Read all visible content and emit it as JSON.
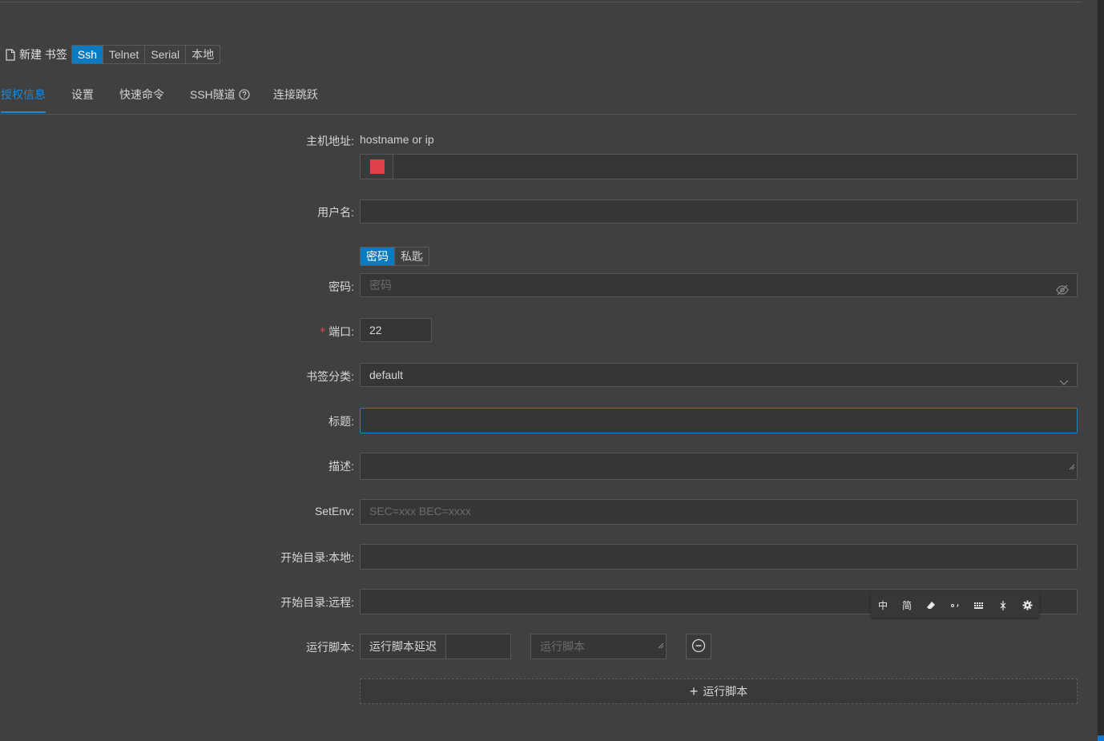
{
  "header": {
    "title": "新建 书签",
    "protocols": [
      "Ssh",
      "Telnet",
      "Serial",
      "本地"
    ],
    "active_protocol": "Ssh"
  },
  "tabs": [
    {
      "label": "授权信息",
      "active": true
    },
    {
      "label": "设置"
    },
    {
      "label": "快速命令"
    },
    {
      "label": "SSH隧道",
      "icon": "question-circle-icon"
    },
    {
      "label": "连接跳跃"
    }
  ],
  "form": {
    "host": {
      "label": "主机地址:",
      "hint": "hostname or ip",
      "color": "#e0424b",
      "value": ""
    },
    "username": {
      "label": "用户名:",
      "value": ""
    },
    "auth_types": [
      "密码",
      "私匙"
    ],
    "password": {
      "label": "密码:",
      "placeholder": "密码"
    },
    "port": {
      "label": "端口:",
      "required_mark": "*",
      "value": "22"
    },
    "category": {
      "label": "书签分类:",
      "value": "default"
    },
    "title": {
      "label": "标题:",
      "value": ""
    },
    "description": {
      "label": "描述:",
      "value": ""
    },
    "setenv": {
      "label": "SetEnv:",
      "placeholder": "SEC=xxx BEC=xxxx"
    },
    "start_dir_local": {
      "label": "开始目录:本地:",
      "value": ""
    },
    "start_dir_remote": {
      "label": "开始目录:远程:",
      "value": ""
    },
    "run_script": {
      "label": "运行脚本:",
      "delay_label": "运行脚本延迟",
      "script_placeholder": "运行脚本",
      "add_label": "运行脚本"
    }
  },
  "ime_toolbar": {
    "items": [
      "中",
      "简",
      "eraser-icon",
      "punctuation-icon",
      "keyboard-icon",
      "cursor-icon",
      "settings-icon"
    ]
  },
  "colors": {
    "accent": "#1a8ad6",
    "background": "#404040",
    "danger": "#e0424b"
  }
}
